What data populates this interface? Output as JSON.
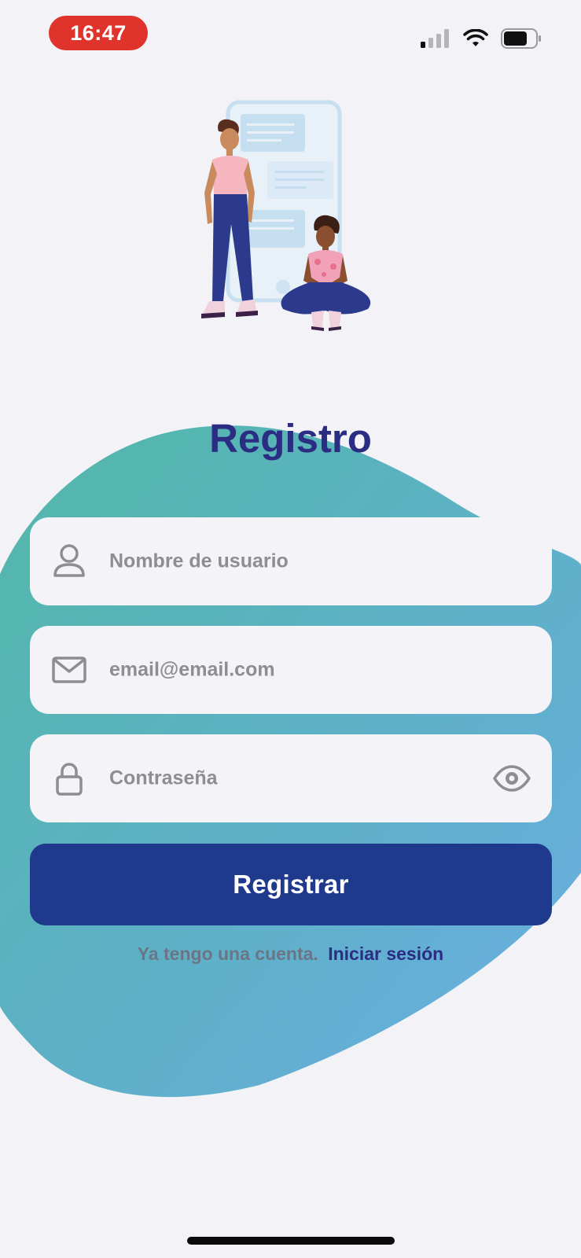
{
  "status_bar": {
    "time": "16:47",
    "recording_badge_color": "#e0332b"
  },
  "colors": {
    "background": "#f3f2f6",
    "blob_start": "#52b8a8",
    "blob_end": "#6aaee3",
    "title": "#2b2d82",
    "button": "#1f3a8d",
    "field": "#f4f3f7",
    "placeholder": "#8e8d93"
  },
  "header": {
    "title": "Registro"
  },
  "form": {
    "username_placeholder": "Nombre de usuario",
    "email_placeholder": "email@email.com",
    "password_placeholder": "Contraseña",
    "username_icon": "user-icon",
    "email_icon": "mail-icon",
    "password_icon": "lock-icon",
    "password_toggle_icon": "eye-icon",
    "submit_label": "Registrar"
  },
  "footer": {
    "prompt": "Ya tengo una cuenta.",
    "login_link": "Iniciar sesión"
  }
}
